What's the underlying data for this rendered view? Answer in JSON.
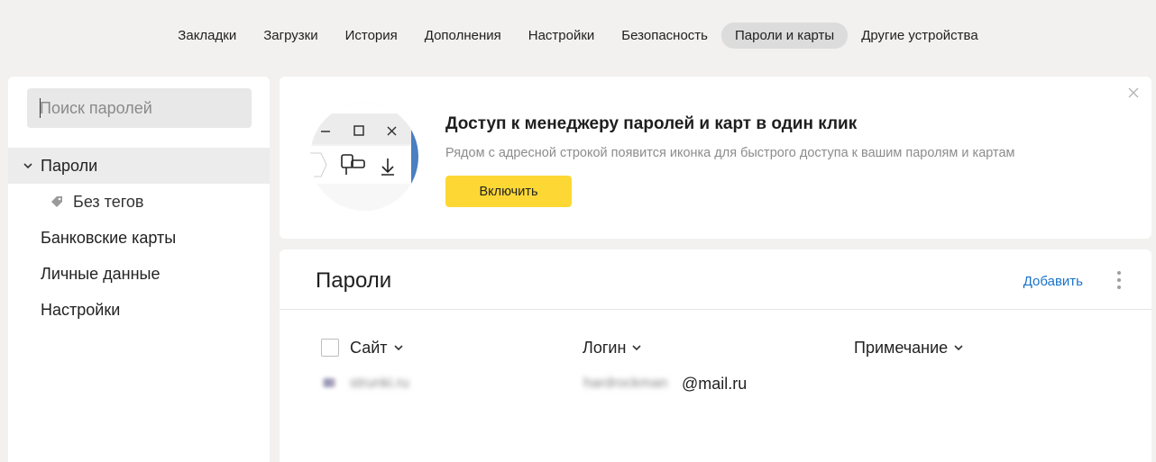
{
  "topnav": {
    "items": [
      {
        "label": "Закладки"
      },
      {
        "label": "Загрузки"
      },
      {
        "label": "История"
      },
      {
        "label": "Дополнения"
      },
      {
        "label": "Настройки"
      },
      {
        "label": "Безопасность"
      },
      {
        "label": "Пароли и карты",
        "active": true
      },
      {
        "label": "Другие устройства"
      }
    ]
  },
  "sidebar": {
    "search_placeholder": "Поиск паролей",
    "items": [
      {
        "label": "Пароли"
      },
      {
        "label": "Без тегов"
      },
      {
        "label": "Банковские карты"
      },
      {
        "label": "Личные данные"
      },
      {
        "label": "Настройки"
      }
    ]
  },
  "promo": {
    "title": "Доступ к менеджеру паролей и карт в один клик",
    "description": "Рядом с адресной строкой появится иконка для быстрого доступа к вашим паролям и картам",
    "button_label": "Включить"
  },
  "panel": {
    "title": "Пароли",
    "add_label": "Добавить",
    "columns": {
      "site": "Сайт",
      "login": "Логин",
      "note": "Примечание"
    },
    "rows": [
      {
        "site": "strunki.ru",
        "login_user": "hardrockman",
        "login_domain": "@mail.ru"
      }
    ]
  },
  "colors": {
    "accent_yellow": "#fdd835",
    "link_blue": "#1a73c9",
    "page_background": "#f2f1ef"
  }
}
